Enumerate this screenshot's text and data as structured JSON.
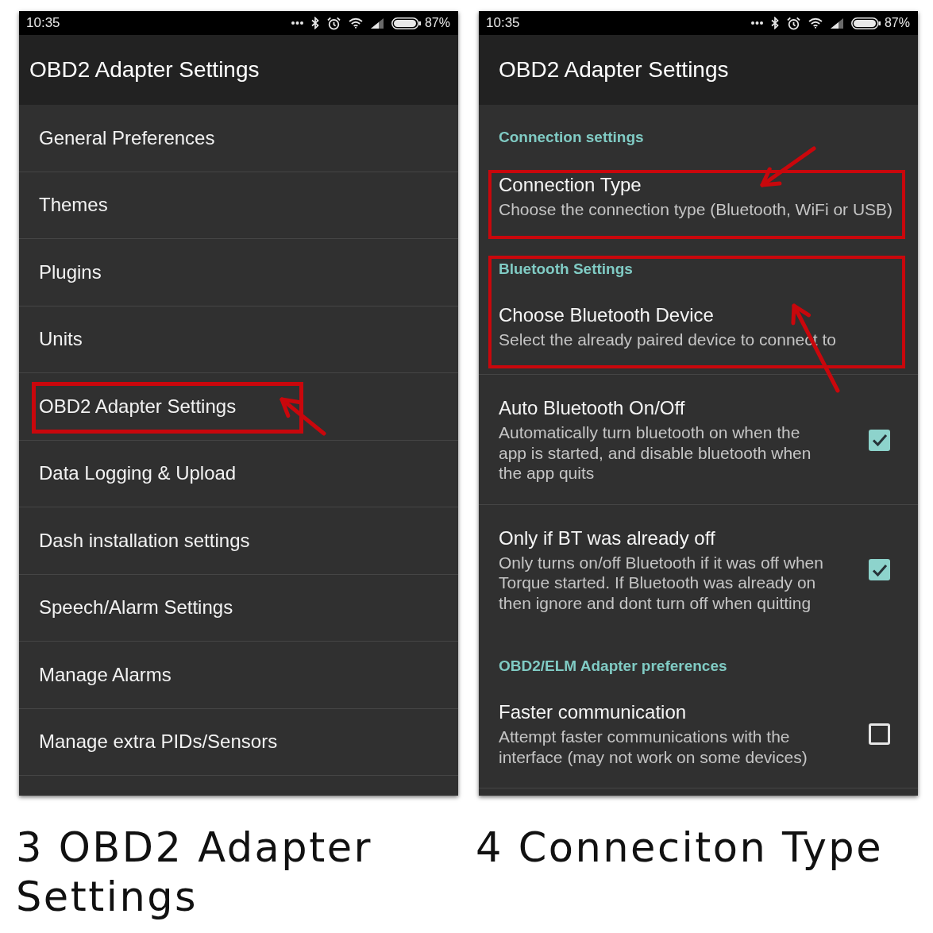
{
  "screens": [
    {
      "kind": "menu",
      "status_bar": {
        "time": "10:35",
        "battery": "87%"
      },
      "app_bar": {
        "title": "OBD2 Adapter Settings"
      },
      "items": [
        {
          "label": "General Preferences",
          "highlighted": false
        },
        {
          "label": "Themes",
          "highlighted": false
        },
        {
          "label": "Plugins",
          "highlighted": false
        },
        {
          "label": "Units",
          "highlighted": false
        },
        {
          "label": "OBD2 Adapter Settings",
          "highlighted": true,
          "arrow": {
            "kind": "up-left"
          }
        },
        {
          "label": "Data Logging & Upload",
          "highlighted": false
        },
        {
          "label": "Dash installation settings",
          "highlighted": false
        },
        {
          "label": "Speech/Alarm Settings",
          "highlighted": false
        },
        {
          "label": "Manage Alarms",
          "highlighted": false
        },
        {
          "label": "Manage extra PIDs/Sensors",
          "highlighted": false
        }
      ],
      "caption": "3 OBD2 Adapter Settings"
    },
    {
      "kind": "preferences",
      "status_bar": {
        "time": "10:35",
        "battery": "87%"
      },
      "app_bar": {
        "title": "OBD2 Adapter Settings"
      },
      "entries": [
        {
          "kind": "header",
          "text": "Connection settings"
        },
        {
          "kind": "group",
          "highlighted": true,
          "arrow": {
            "kind": "down-left"
          },
          "rows": [
            {
              "kind": "item",
              "title": "Connection Type",
              "summary": "Choose the connection type (Bluetooth, WiFi or USB)"
            }
          ]
        },
        {
          "kind": "group",
          "highlighted": true,
          "arrow": {
            "kind": "up"
          },
          "rows": [
            {
              "kind": "header",
              "text": "Bluetooth Settings"
            },
            {
              "kind": "item",
              "title": "Choose Bluetooth Device",
              "summary": "Select the already paired device to connect to"
            }
          ]
        },
        {
          "kind": "checkbox",
          "title": "Auto Bluetooth On/Off",
          "summary": "Automatically turn bluetooth on when the app is started, and disable bluetooth when the app quits",
          "checked": true
        },
        {
          "kind": "checkbox",
          "title": "Only if BT was already off",
          "summary": "Only turns on/off Bluetooth if it was off when Torque started. If Bluetooth was already on then ignore and dont turn off when quitting",
          "checked": true
        },
        {
          "kind": "header",
          "text": "OBD2/ELM Adapter preferences"
        },
        {
          "kind": "checkbox",
          "title": "Faster communication",
          "summary": "Attempt faster communications with the interface (may not work on some devices)",
          "checked": false
        }
      ],
      "caption": "4 Conneciton Type"
    }
  ]
}
